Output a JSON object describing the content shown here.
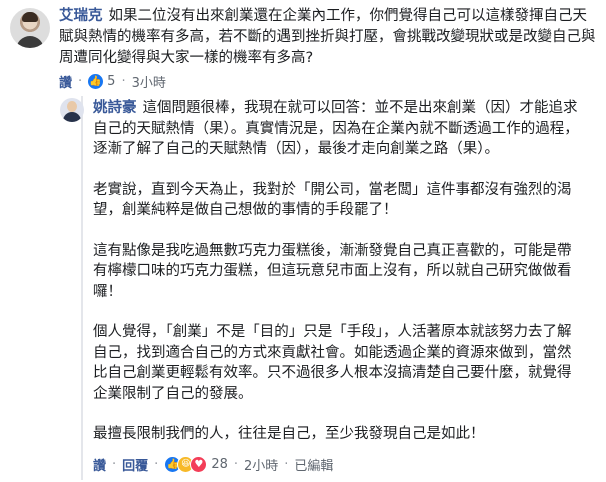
{
  "root_comment": {
    "author": "艾瑞克",
    "text": "如果二位沒有出來創業還在企業內工作，你們覺得自己可以這樣發揮自己天賦與熱情的機率有多高，若不斷的遇到挫折與打壓，會挑戰改變現狀或是改變自己與周遭同化變得與大家一樣的機率有多高?",
    "actions": {
      "like_label": "讚",
      "reply_label": "回覆",
      "reaction_count": "5",
      "time": "3小時"
    }
  },
  "reply": {
    "author": "姚詩豪",
    "paragraphs": [
      "這個問題很棒，我現在就可以回答：並不是出來創業（因）才能追求自己的天賦熱情（果）。真實情況是，因為在企業內就不斷透過工作的過程，逐漸了解了自己的天賦熱情（因），最後才走向創業之路（果）。",
      "老實說，直到今天為止，我對於「開公司，當老闆」這件事都沒有強烈的渴望，創業純粹是做自己想做的事情的手段罷了！",
      "這有點像是我吃過無數巧克力蛋糕後，漸漸發覺自己真正喜歡的，可能是帶有檸檬口味的巧克力蛋糕，但這玩意兒市面上沒有，所以就自己研究做做看囉！",
      "個人覺得，「創業」不是「目的」只是「手段」，人活著原本就該努力去了解自己，找到適合自己的方式來貢獻社會。如能透過企業的資源來做到，當然比自己創業更輕鬆有效率。只不過很多人根本沒搞清楚自己要什麼，就覺得企業限制了自己的發展。",
      "最擅長限制我們的人，往往是自己，至少我發現自己是如此！"
    ],
    "actions": {
      "like_label": "讚",
      "reply_label": "回覆",
      "reaction_count": "28",
      "time": "2小時",
      "edited_label": "已編輯"
    }
  },
  "icons": {
    "like": "like-icon",
    "haha": "haha-icon",
    "love": "love-icon"
  }
}
